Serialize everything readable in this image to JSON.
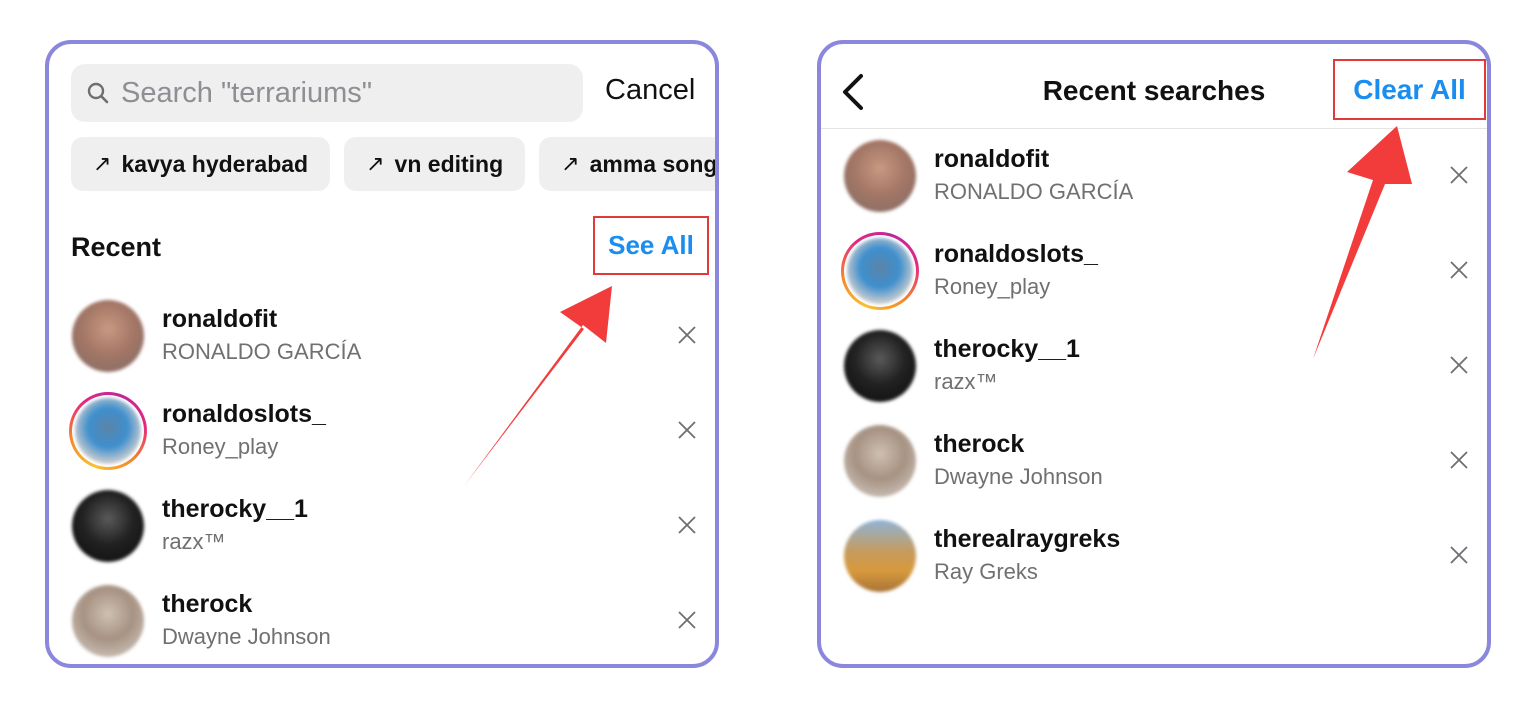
{
  "left_panel": {
    "search": {
      "placeholder": "Search \"terrariums\"",
      "icon": "search-icon"
    },
    "cancel_label": "Cancel",
    "suggestions": [
      {
        "label": "kavya hyderabad",
        "icon": "trending-arrow-icon"
      },
      {
        "label": "vn editing",
        "icon": "trending-arrow-icon"
      },
      {
        "label": "amma song",
        "icon": "trending-arrow-icon"
      }
    ],
    "recent_heading": "Recent",
    "see_all_label": "See All",
    "items": [
      {
        "username": "ronaldofit",
        "full_name": "RONALDO GARCÍA",
        "story_ring": false
      },
      {
        "username": "ronaldoslots_",
        "full_name": "Roney_play",
        "story_ring": true
      },
      {
        "username": "therocky__1",
        "full_name": "razx™",
        "story_ring": false
      },
      {
        "username": "therock",
        "full_name": "Dwayne Johnson",
        "story_ring": false
      }
    ]
  },
  "right_panel": {
    "title": "Recent searches",
    "clear_all_label": "Clear All",
    "items": [
      {
        "username": "ronaldofit",
        "full_name": "RONALDO GARCÍA",
        "story_ring": false
      },
      {
        "username": "ronaldoslots_",
        "full_name": "Roney_play",
        "story_ring": true
      },
      {
        "username": "therocky__1",
        "full_name": "razx™",
        "story_ring": false
      },
      {
        "username": "therock",
        "full_name": "Dwayne Johnson",
        "story_ring": false
      },
      {
        "username": "therealraygreks",
        "full_name": "Ray Greks",
        "story_ring": false
      }
    ]
  },
  "colors": {
    "panel_border": "#8b87dc",
    "link_blue": "#1a8df0",
    "highlight_red": "#e03a3a",
    "annotation_arrow": "#f23b3b"
  }
}
